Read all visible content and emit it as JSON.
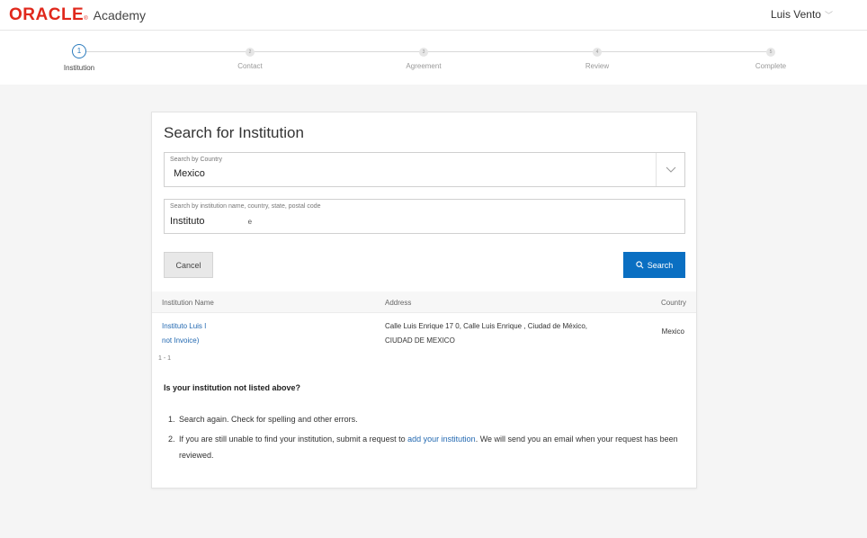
{
  "header": {
    "logo_oracle": "ORACLE",
    "logo_tm": "®",
    "logo_academy": "Academy",
    "user_name": "Luis Vento",
    "user_chevron": "﹀"
  },
  "stepper": {
    "steps": [
      {
        "number": "1",
        "label": "Institution"
      },
      {
        "number": "2",
        "label": "Contact"
      },
      {
        "number": "3",
        "label": "Agreement"
      },
      {
        "number": "4",
        "label": "Review"
      },
      {
        "number": "5",
        "label": "Complete"
      }
    ],
    "active_step": 1
  },
  "form": {
    "title": "Search for Institution",
    "country_label": "Search by Country",
    "country_value": "Mexico",
    "search_label": "Search by institution name, country, state, postal code",
    "search_value": "Instituto",
    "search_value_tail": "e",
    "cancel_label": "Cancel",
    "search_button_label": "Search"
  },
  "results": {
    "columns": [
      "Institution Name",
      "Address",
      "Country"
    ],
    "rows": [
      {
        "name_line1": "Instituto Luis I",
        "name_line2": "not Invoice)",
        "address_line1": "Calle Luis Enrique 17 0, Calle Luis Enrique , Ciudad de México,",
        "address_line2": "CIUDAD DE MEXICO",
        "country": "Mexico"
      }
    ],
    "pagination": "1 - 1"
  },
  "help": {
    "title": "Is your institution not listed above?",
    "item1_num": "1.",
    "item1": "Search again. Check for spelling and other errors.",
    "item2_num": "2.",
    "item2_pre": "If you are still unable to find your institution, submit a request to ",
    "item2_link": "add your institution",
    "item2_post": ". We will send you an email when your request has been reviewed."
  },
  "colors": {
    "brand_red": "#e0281c",
    "primary_blue": "#0a6fc2",
    "link_blue": "#2369b1"
  }
}
